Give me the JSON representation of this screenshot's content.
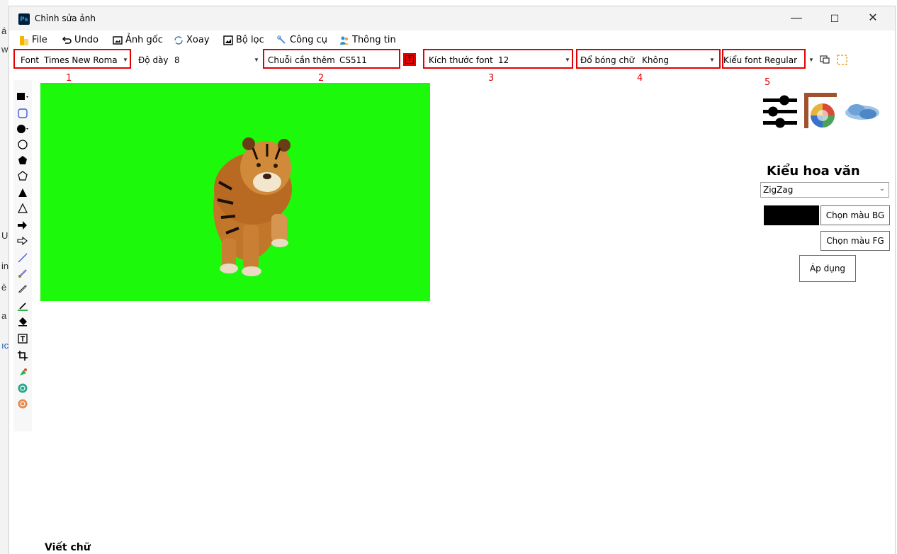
{
  "window": {
    "title": "Chỉnh sửa ảnh",
    "app_icon": "Ps",
    "controls": {
      "minimize": "—",
      "maximize": "☐",
      "close": "✕"
    }
  },
  "background_app_glyphs": [
    "á",
    "w",
    "U",
    "in",
    "è",
    "a",
    "ıc"
  ],
  "menu": {
    "items": [
      {
        "label": "File",
        "icon": "folder-icon"
      },
      {
        "label": "Undo",
        "icon": "undo-icon"
      },
      {
        "label": "Ảnh gốc",
        "icon": "image-icon"
      },
      {
        "label": "Xoay",
        "icon": "rotate-icon"
      },
      {
        "label": "Bộ lọc",
        "icon": "filter-icon"
      },
      {
        "label": "Công cụ",
        "icon": "wrench-icon"
      },
      {
        "label": "Thông tin",
        "icon": "info-users-icon"
      }
    ]
  },
  "toolbar": {
    "font_label": "Font",
    "font_value": "Times New Roman",
    "thickness_label": "Độ dày",
    "thickness_value": "8",
    "string_label": "Chuỗi cần thêm",
    "string_value": "CS511",
    "text_button_glyph": "T",
    "font_size_label": "Kích thước font",
    "font_size_value": "12",
    "shadow_label": "Đổ bóng chữ",
    "shadow_value": "Không",
    "font_style_label": "Kiểu font",
    "font_style_value": "Regular"
  },
  "annotations": [
    "1",
    "2",
    "3",
    "4",
    "5"
  ],
  "tools": [
    "filled-rectangle-icon",
    "rounded-rectangle-icon",
    "filled-circle-icon",
    "circle-icon",
    "filled-pentagon-icon",
    "pentagon-icon",
    "filled-triangle-icon",
    "triangle-icon",
    "filled-arrow-icon",
    "arrow-icon",
    "line-icon",
    "brush-icon",
    "pencil-icon",
    "color-picker-icon",
    "eraser-icon",
    "text-tool-icon",
    "crop-icon",
    "fill-icon",
    "zoom-in-icon",
    "zoom-out-icon"
  ],
  "canvas": {
    "background": "#1cf90a",
    "subject": "tiger"
  },
  "right_panel": {
    "pattern_title": "Kiểu hoa văn",
    "pattern_value": "ZigZag",
    "bg_button": "Chọn màu BG",
    "fg_button": "Chọn màu FG",
    "apply_button": "Áp dụng",
    "bg_color": "#000000",
    "icons": [
      "sliders-icon",
      "color-wheel-icon",
      "cloud-brush-icon"
    ]
  },
  "footer": {
    "write_label": "Viết chữ"
  },
  "colors": {
    "accent_red": "#e30000",
    "canvas_green": "#1cf90a"
  }
}
